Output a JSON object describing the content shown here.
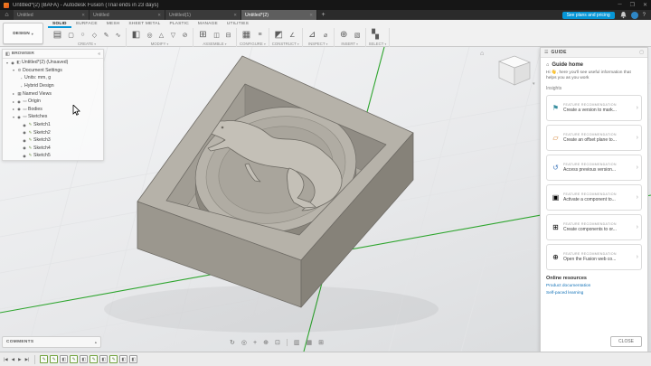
{
  "title_bar": {
    "title": "Untitled*(2) (BAFA) - Autodesk Fusion (Trial ends in 23 days)"
  },
  "tab_strip": {
    "tabs": [
      {
        "label": "Untitled"
      },
      {
        "label": "Untitled"
      },
      {
        "label": "Untitled(1)"
      },
      {
        "label": "Untitled*(2)"
      }
    ],
    "plans_button": "See plans and pricing"
  },
  "toolbar": {
    "workspace": "DESIGN",
    "tabs": [
      {
        "label": "SOLID"
      },
      {
        "label": "SURFACE"
      },
      {
        "label": "MESH"
      },
      {
        "label": "SHEET METAL"
      },
      {
        "label": "PLASTIC"
      },
      {
        "label": "MANAGE"
      },
      {
        "label": "UTILITIES"
      }
    ],
    "groups": [
      {
        "label": "CREATE"
      },
      {
        "label": "MODIFY"
      },
      {
        "label": "ASSEMBLE"
      },
      {
        "label": "CONFIGURE"
      },
      {
        "label": "CONSTRUCT"
      },
      {
        "label": "INSPECT"
      },
      {
        "label": "INSERT"
      },
      {
        "label": "SELECT"
      }
    ]
  },
  "browser": {
    "header": "BROWSER",
    "root_label": "Untitled*(2) (Unsaved)",
    "items": [
      {
        "label": "Document Settings"
      },
      {
        "label": "Units: mm, g"
      },
      {
        "label": "Hybrid Design"
      },
      {
        "label": "Named Views"
      },
      {
        "label": "Origin"
      },
      {
        "label": "Bodies"
      },
      {
        "label": "Sketches"
      },
      {
        "label": "Sketch1"
      },
      {
        "label": "Sketch2"
      },
      {
        "label": "Sketch3"
      },
      {
        "label": "Sketch4"
      },
      {
        "label": "Sketch5"
      }
    ]
  },
  "guide": {
    "header": "GUIDE",
    "home_title": "Guide home",
    "intro": "Hi 👋, here you'll see useful information that helps you as you work",
    "insights_label": "Insights",
    "card_kicker": "FEATURE RECOMMENDATION",
    "cards": [
      {
        "title": "Create a version to mark..."
      },
      {
        "title": "Create an offset plane to..."
      },
      {
        "title": "Access previous version..."
      },
      {
        "title": "Activate a component to..."
      },
      {
        "title": "Create components to or..."
      },
      {
        "title": "Open the Fusion web co..."
      }
    ],
    "online_resources": "Online resources",
    "links": [
      {
        "label": "Product documentation"
      },
      {
        "label": "Self-paced learning"
      }
    ],
    "close_button": "CLOSE"
  },
  "comments": {
    "label": "COMMENTS"
  },
  "timeline": {
    "features": [
      "sketch",
      "sketch",
      "extrude",
      "sketch",
      "extrude",
      "sketch",
      "extrude",
      "sketch",
      "extrude",
      "extrude"
    ]
  },
  "icons": {
    "minimize": "─",
    "maximize": "❐",
    "close": "✕",
    "home": "⌂",
    "plus": "+",
    "help": "?",
    "menu": "☰",
    "dock": "▢",
    "caret_down": "▾",
    "caret_right": "▸",
    "chevron_right": "›",
    "collapse_left": "«",
    "expand_up": "▴",
    "browser_doc": "◧",
    "eye_on": "◉",
    "gear": "⚙",
    "small_item": "▫",
    "camera": "▦",
    "folder": "▭",
    "sketch_node": "✎",
    "version": "⚑",
    "offset_plane": "▱",
    "history": "↺",
    "component": "▣",
    "components": "⊞",
    "web": "⊕",
    "orbit": "↻",
    "look_at": "◎",
    "pan": "+",
    "zoom": "⊕",
    "fit": "⊡",
    "display": "▥",
    "grid": "▦",
    "viewports": "⊞",
    "skip_start": "|◀",
    "step_back": "◀",
    "play": "▶",
    "skip_end": "▶|",
    "sketch_feature": "✎",
    "extrude_feature": "◧"
  },
  "colors": {
    "accent_blue": "#0696d7",
    "axis_green": "#2ea52e",
    "model_top": "#b6b2a9",
    "model_side": "#9b978e"
  }
}
